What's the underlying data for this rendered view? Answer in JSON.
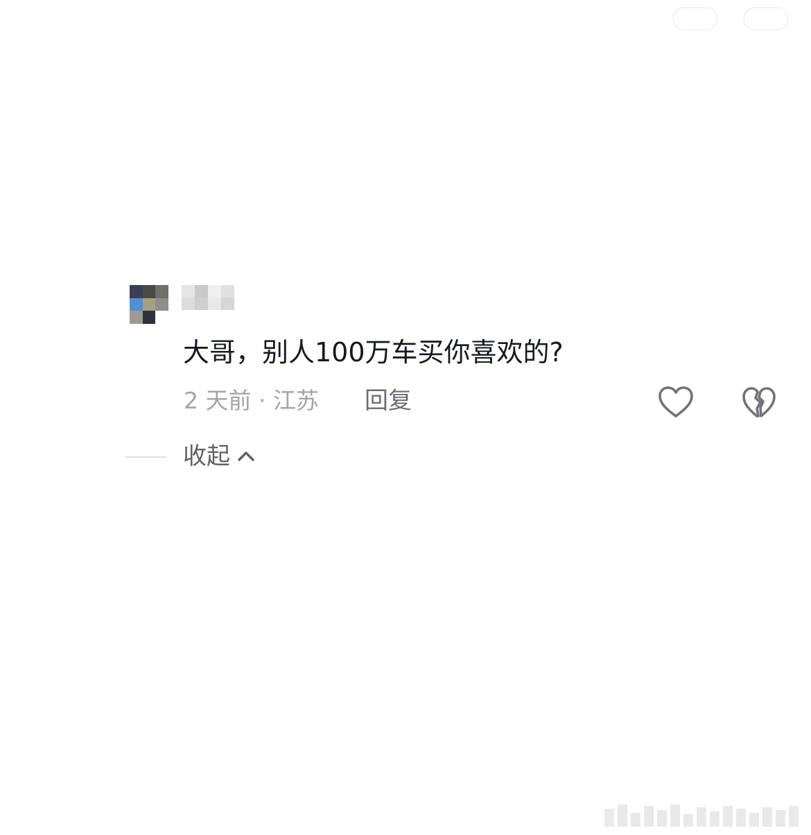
{
  "comment": {
    "text": "大哥，别人100万车买你喜欢的?",
    "meta": "2 天前 · 江苏",
    "reply_label": "回复",
    "collapse_label": "收起"
  },
  "icons": {
    "like": "heart-outline-icon",
    "dislike": "broken-heart-icon",
    "collapse": "chevron-up-icon"
  },
  "colors": {
    "primary_text": "#161823",
    "secondary_text": "#a3a4ab",
    "action_text": "#6b6c74",
    "icon_stroke": "#70717a"
  }
}
